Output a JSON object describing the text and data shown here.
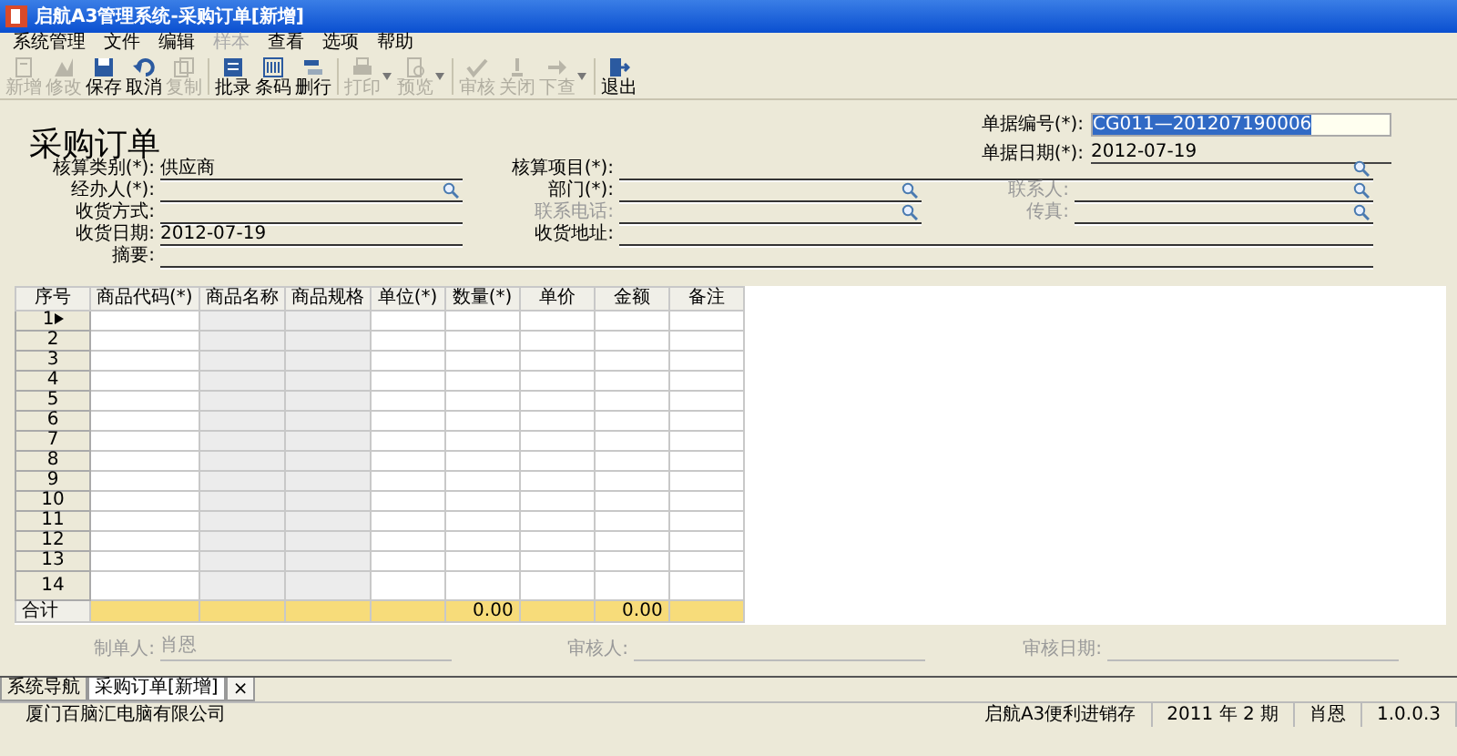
{
  "window": {
    "title": "启航A3管理系统-采购订单[新增]"
  },
  "menu": [
    {
      "label": "系统管理",
      "disabled": false
    },
    {
      "label": "文件",
      "disabled": false
    },
    {
      "label": "编辑",
      "disabled": false
    },
    {
      "label": "样本",
      "disabled": true
    },
    {
      "label": "查看",
      "disabled": false
    },
    {
      "label": "选项",
      "disabled": false
    },
    {
      "label": "帮助",
      "disabled": false
    }
  ],
  "toolbar": [
    {
      "label": "新增",
      "disabled": true,
      "has_menu": false
    },
    {
      "label": "修改",
      "disabled": true,
      "has_menu": false
    },
    {
      "label": "保存",
      "disabled": false,
      "has_menu": false
    },
    {
      "label": "取消",
      "disabled": false,
      "has_menu": false
    },
    {
      "label": "复制",
      "disabled": true,
      "has_menu": false
    },
    {
      "label": "批录",
      "disabled": false,
      "has_menu": false
    },
    {
      "label": "条码",
      "disabled": false,
      "has_menu": false
    },
    {
      "label": "删行",
      "disabled": false,
      "has_menu": false
    },
    {
      "label": "打印",
      "disabled": true,
      "has_menu": true
    },
    {
      "label": "预览",
      "disabled": true,
      "has_menu": true
    },
    {
      "label": "审核",
      "disabled": true,
      "has_menu": false
    },
    {
      "label": "关闭",
      "disabled": true,
      "has_menu": false
    },
    {
      "label": "下查",
      "disabled": true,
      "has_menu": true
    },
    {
      "label": "退出",
      "disabled": false,
      "has_menu": false
    }
  ],
  "form": {
    "title": "采购订单",
    "header_fields": [
      {
        "label": "单据编号(*):",
        "value": "CG011—201207190006",
        "value_selected": true,
        "boxed": true
      },
      {
        "label": "单据日期(*):",
        "value": "2012-07-19",
        "value_selected": false,
        "boxed": false
      }
    ],
    "rows": [
      [
        {
          "label": "核算类别(*):",
          "value": "供应商",
          "disabled": false
        },
        {
          "label": "核算项目(*):",
          "lookup": true,
          "disabled": false
        }
      ],
      [
        {
          "label": "经办人(*):",
          "lookup": true,
          "disabled": false
        },
        {
          "label": "部门(*):",
          "lookup": true,
          "disabled": false
        },
        {
          "label": "联系人:",
          "lookup": true,
          "disabled": true
        }
      ],
      [
        {
          "label": "收货方式:",
          "disabled": false
        },
        {
          "label": "联系电话:",
          "lookup": true,
          "disabled": true
        },
        {
          "label": "传真:",
          "lookup": true,
          "disabled": true
        }
      ],
      [
        {
          "label": "收货日期:",
          "value": "2012-07-19",
          "disabled": false
        },
        {
          "label": "收货地址:",
          "disabled": false
        }
      ],
      [
        {
          "label": "摘要:",
          "disabled": false
        }
      ]
    ]
  },
  "grid": {
    "columns": [
      {
        "label": "序号",
        "total": "合计"
      },
      {
        "label": "商品代码(*)"
      },
      {
        "label": "商品名称",
        "readonly": true
      },
      {
        "label": "商品规格",
        "readonly": true
      },
      {
        "label": "单位(*)"
      },
      {
        "label": "数量(*)",
        "total": "0.00"
      },
      {
        "label": "单价"
      },
      {
        "label": "金额",
        "total": "0.00"
      },
      {
        "label": "备注"
      }
    ],
    "rows": [
      {
        "number": "1",
        "selected": true
      },
      {
        "number": "2",
        "selected": false
      },
      {
        "number": "3",
        "selected": false
      },
      {
        "number": "4",
        "selected": false
      },
      {
        "number": "5",
        "selected": false
      },
      {
        "number": "6",
        "selected": false
      },
      {
        "number": "7",
        "selected": false
      },
      {
        "number": "8",
        "selected": false
      },
      {
        "number": "9",
        "selected": false
      },
      {
        "number": "10",
        "selected": false
      },
      {
        "number": "11",
        "selected": false
      },
      {
        "number": "12",
        "selected": false
      },
      {
        "number": "13",
        "selected": false
      },
      {
        "number": "14",
        "selected": false
      }
    ]
  },
  "signatures": [
    {
      "label": "制单人:",
      "value": "肖恩",
      "disabled": true
    },
    {
      "label": "审核人:",
      "disabled": true
    },
    {
      "label": "审核日期:",
      "disabled": true
    }
  ],
  "tabs": [
    {
      "label": "系统导航",
      "selected": false
    },
    {
      "label": "采购订单[新增]",
      "selected": true,
      "close": "×"
    }
  ],
  "status_bar": [
    "厦门百脑汇电脑有限公司",
    "启航A3便利进销存",
    "2011 年 2 期",
    "肖恩",
    "1.0.0.3"
  ]
}
